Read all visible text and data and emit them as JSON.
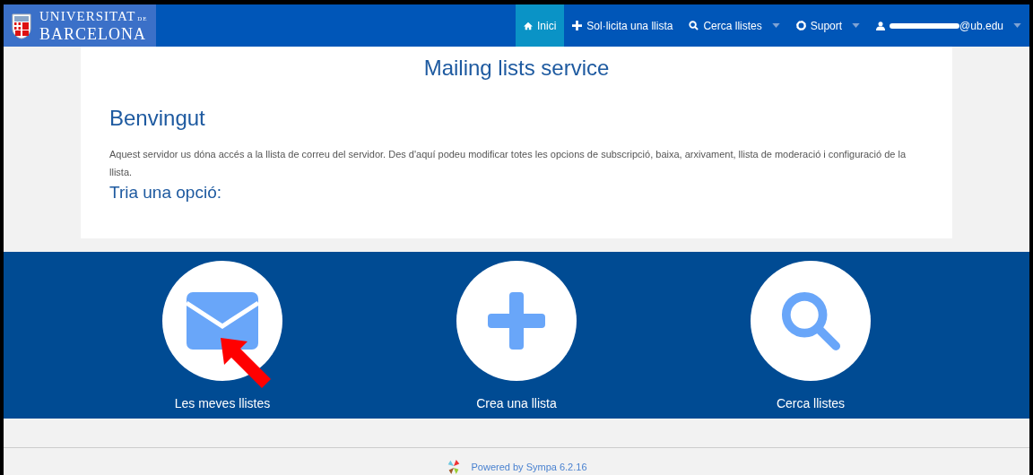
{
  "logo": {
    "line1": "UNIVERSITAT",
    "line1_suffix": "DE",
    "line2": "BARCELONA"
  },
  "nav": [
    {
      "label": "Inici",
      "selected": true,
      "dropdown": false
    },
    {
      "label": "Sol·licita una llista",
      "selected": false,
      "dropdown": false
    },
    {
      "label": "Cerca llistes",
      "selected": false,
      "dropdown": true
    },
    {
      "label": "Suport",
      "selected": false,
      "dropdown": true
    },
    {
      "label": "@ub.edu",
      "selected": false,
      "dropdown": true,
      "redacted": true
    }
  ],
  "page_title": "Mailing lists service",
  "welcome": {
    "heading": "Benvingut",
    "text": "Aquest servidor us dóna accés a la llista de correu del servidor. Des d'aquí podeu modificar totes les opcions de subscripció, baixa, arxivament, llista de moderació i configuració de la llista.",
    "subheading": "Tria una opció:"
  },
  "options": [
    {
      "label": "Les meves llistes",
      "highlighted": true
    },
    {
      "label": "Crea una llista",
      "highlighted": false
    },
    {
      "label": "Cerca llistes",
      "highlighted": false
    }
  ],
  "footer": {
    "text": "Powered by Sympa 6.2.16"
  }
}
